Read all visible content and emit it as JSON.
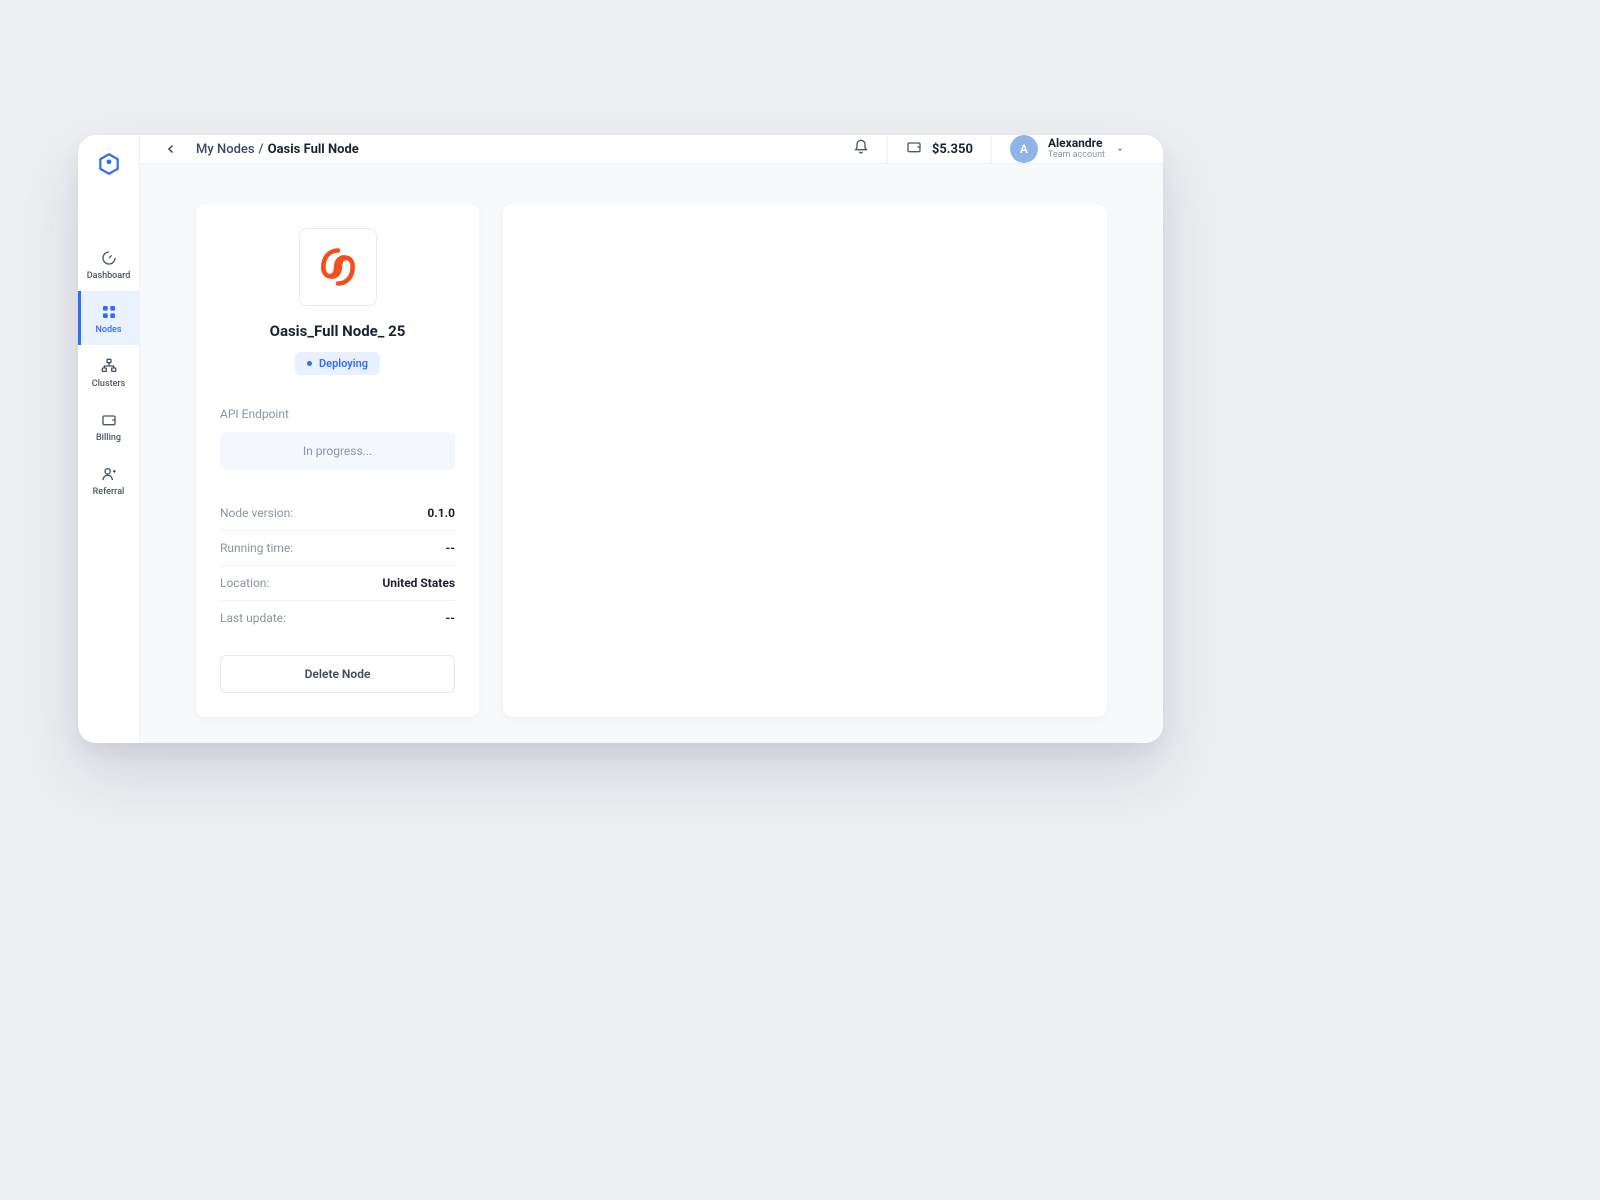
{
  "sidebar": {
    "items": [
      {
        "label": "Dashboard"
      },
      {
        "label": "Nodes"
      },
      {
        "label": "Clusters"
      },
      {
        "label": "Billing"
      },
      {
        "label": "Referral"
      }
    ]
  },
  "header": {
    "breadcrumb_root": "My Nodes",
    "breadcrumb_sep": "/",
    "breadcrumb_current": "Oasis Full Node",
    "balance": "$5.350",
    "user_name": "Alexandre",
    "user_sub": "Team account",
    "avatar_initial": "A"
  },
  "node": {
    "title": "Oasis_Full Node_ 25",
    "status": "Deploying",
    "endpoint_label": "API Endpoint",
    "endpoint_value": "In progress...",
    "rows": [
      {
        "key": "Node version:",
        "val": "0.1.0"
      },
      {
        "key": "Running time:",
        "val": "--"
      },
      {
        "key": "Location:",
        "val": "United States"
      },
      {
        "key": "Last update:",
        "val": "--"
      }
    ],
    "delete_label": "Delete Node"
  }
}
